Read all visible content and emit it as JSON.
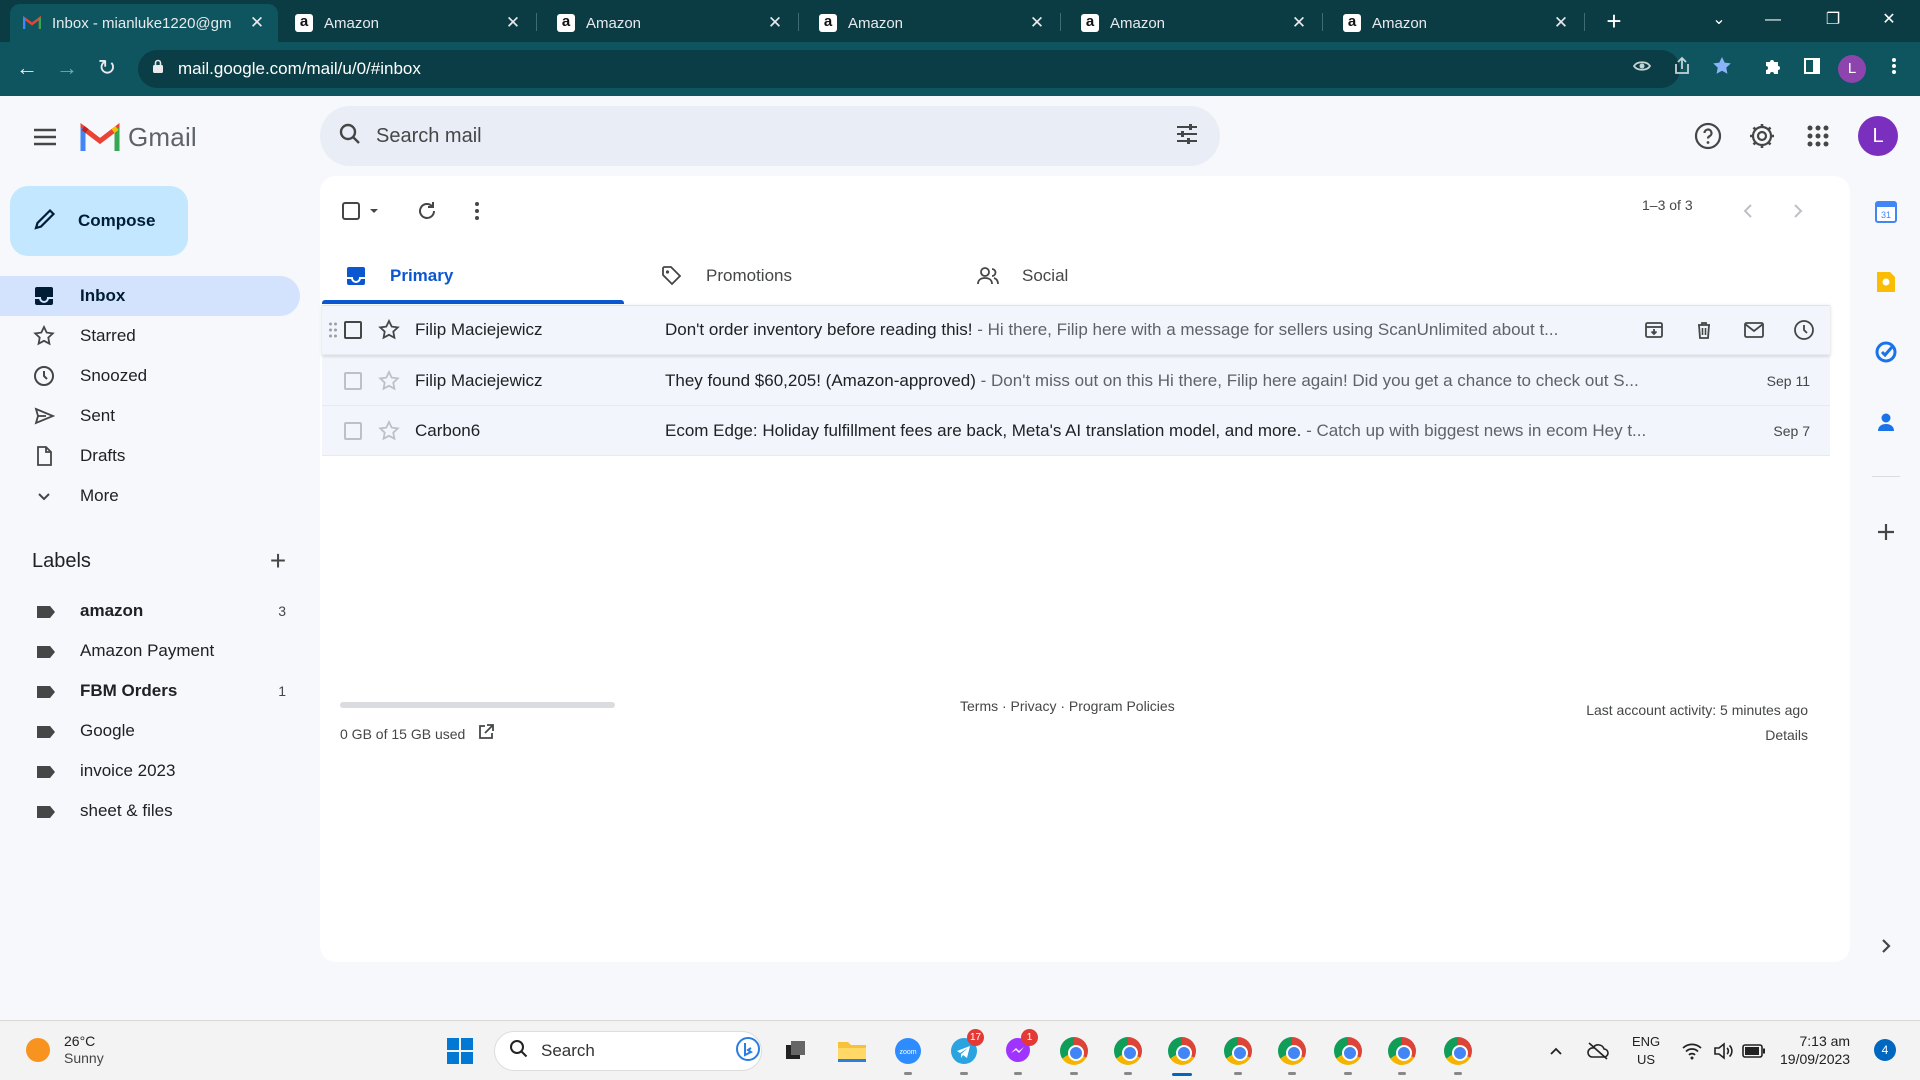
{
  "browser": {
    "tabs": [
      {
        "title": "Inbox - mianluke1220@gm",
        "favicon": "gmail-icon"
      },
      {
        "title": "Amazon",
        "favicon": "amazon-icon"
      },
      {
        "title": "Amazon",
        "favicon": "amazon-icon"
      },
      {
        "title": "Amazon",
        "favicon": "amazon-icon"
      },
      {
        "title": "Amazon",
        "favicon": "amazon-icon"
      },
      {
        "title": "Amazon",
        "favicon": "amazon-icon"
      }
    ],
    "url": "mail.google.com/mail/u/0/#inbox",
    "profile_initial": "L"
  },
  "gmail": {
    "logo_text": "Gmail",
    "search_placeholder": "Search mail",
    "avatar_initial": "L",
    "compose_label": "Compose",
    "nav": [
      {
        "label": "Inbox",
        "icon": "inbox-icon",
        "active": true
      },
      {
        "label": "Starred",
        "icon": "star-icon"
      },
      {
        "label": "Snoozed",
        "icon": "clock-icon"
      },
      {
        "label": "Sent",
        "icon": "send-icon"
      },
      {
        "label": "Drafts",
        "icon": "draft-icon"
      },
      {
        "label": "More",
        "icon": "chevron-down-icon"
      }
    ],
    "labels_title": "Labels",
    "labels": [
      {
        "name": "amazon",
        "count": "3",
        "bold": true
      },
      {
        "name": "Amazon Payment",
        "count": ""
      },
      {
        "name": "FBM Orders",
        "count": "1",
        "bold": true
      },
      {
        "name": "Google",
        "count": ""
      },
      {
        "name": "invoice 2023",
        "count": ""
      },
      {
        "name": "sheet & files",
        "count": ""
      }
    ],
    "pager": "1–3 of 3",
    "tabs": [
      {
        "label": "Primary",
        "icon": "inbox-icon",
        "active": true
      },
      {
        "label": "Promotions",
        "icon": "tag-icon"
      },
      {
        "label": "Social",
        "icon": "people-icon"
      }
    ],
    "emails": [
      {
        "sender": "Filip Maciejewicz",
        "subject": "Don't order inventory before reading this!",
        "snippet": " - Hi there, Filip here with a message for sellers using ScanUnlimited about t...",
        "date": ""
      },
      {
        "sender": "Filip Maciejewicz",
        "subject": "They found $60,205! (Amazon-approved)",
        "snippet": " - Don't miss out on this Hi there, Filip here again! Did you get a chance to check out S...",
        "date": "Sep 11"
      },
      {
        "sender": "Carbon6",
        "subject": "Ecom Edge: Holiday fulfillment fees are back, Meta's AI translation model, and more.",
        "snippet": " - Catch up with biggest news in ecom Hey t...",
        "date": "Sep 7"
      }
    ],
    "storage": {
      "text": "0 GB of 15 GB used",
      "used_fraction": 0
    },
    "footer_links": "Terms · Privacy · Program Policies",
    "activity": "Last account activity: 5 minutes ago",
    "details": "Details"
  },
  "taskbar": {
    "temperature": "26°C",
    "condition": "Sunny",
    "search_label": "Search",
    "telegram_badge": "17",
    "messenger_badge": "1",
    "lang": "ENG",
    "region": "US",
    "time": "7:13 am",
    "date": "19/09/2023",
    "notifications": "4"
  }
}
